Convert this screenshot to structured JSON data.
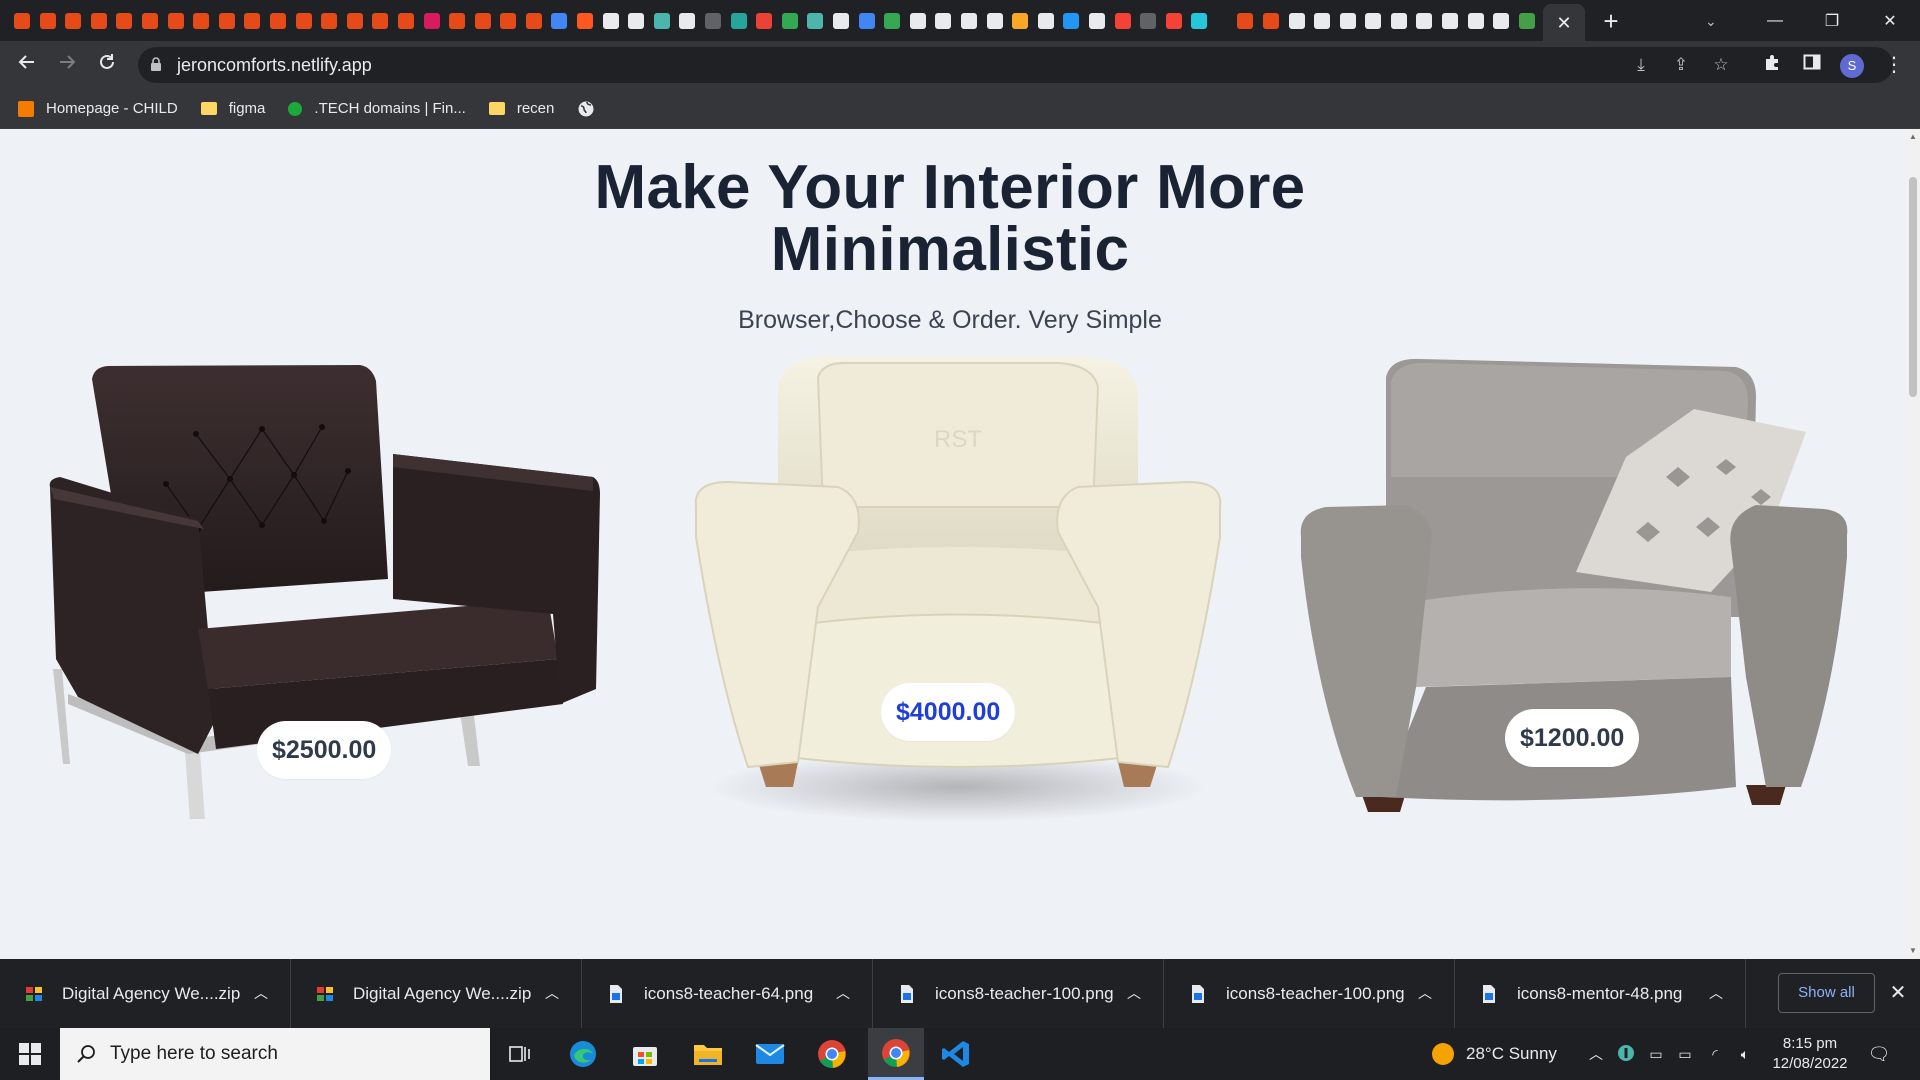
{
  "browser": {
    "favicon_colors": [
      "#e64a19",
      "#e64a19",
      "#e64a19",
      "#e64a19",
      "#e64a19",
      "#e64a19",
      "#e64a19",
      "#e64a19",
      "#e64a19",
      "#e64a19",
      "#e64a19",
      "#e64a19",
      "#e64a19",
      "#e64a19",
      "#e64a19",
      "#e64a19",
      "#d81b60",
      "#e64a19",
      "#e64a19",
      "#e64a19",
      "#e64a19",
      "#4285f4",
      "#ff5722",
      "#e8eaed",
      "#e8eaed",
      "#4db6ac",
      "#e8eaed",
      "#5f6368",
      "#26a69a",
      "#ea4335",
      "#34a853",
      "#4db6ac",
      "#e8eaed",
      "#4285f4",
      "#34a853",
      "#e8eaed",
      "#e8eaed",
      "#e8eaed",
      "#e8eaed",
      "#f9a825",
      "#e8eaed",
      "#2196f3",
      "#e8eaed",
      "#f44336",
      "#5f6368",
      "#f44336",
      "#26c6da",
      "#e64a19",
      "#e64a19",
      "#e8eaed",
      "#e8eaed",
      "#e8eaed",
      "#e8eaed",
      "#e8eaed",
      "#e8eaed",
      "#e8eaed",
      "#e8eaed",
      "#e8eaed",
      "#43a047",
      "#e8eaed"
    ],
    "active_tab_close": "✕",
    "new_tab": "+",
    "window_controls": {
      "search_tabs": "⌄",
      "minimize": "—",
      "restore": "❐",
      "close": "✕"
    },
    "url": "jeroncomforts.netlify.app",
    "toolbar_icons": [
      "install-icon",
      "share-icon",
      "star-icon",
      "extensions-icon",
      "sidepanel-icon"
    ],
    "profile_initial": "S"
  },
  "bookmarks": [
    {
      "label": "Homepage - CHILD",
      "icon": "child-site-icon",
      "color": "#f57c00"
    },
    {
      "label": "figma",
      "icon": "folder-icon",
      "color": "#fdd663"
    },
    {
      "label": ".TECH domains | Fin...",
      "icon": "green-dot-icon",
      "color": "#1fa83a"
    },
    {
      "label": "recen",
      "icon": "folder-icon",
      "color": "#fdd663"
    },
    {
      "label": "",
      "icon": "globe-icon",
      "color": "#e8eaed"
    }
  ],
  "page": {
    "title_line1": "Make Your Interior More",
    "title_line2": "Minimalistic",
    "subtitle": "Browser,Choose & Order. Very Simple",
    "products": [
      {
        "name": "black leather armchair",
        "price": "$2500.00",
        "highlight": false
      },
      {
        "name": "cream leather armchair",
        "price": "$4000.00",
        "highlight": true
      },
      {
        "name": "grey fabric armchair",
        "price": "$1200.00",
        "highlight": false
      }
    ]
  },
  "downloads": {
    "items": [
      {
        "name": "Digital Agency We....zip",
        "type": "zip"
      },
      {
        "name": "Digital Agency We....zip",
        "type": "zip"
      },
      {
        "name": "icons8-teacher-64.png",
        "type": "png"
      },
      {
        "name": "icons8-teacher-100.png",
        "type": "png"
      },
      {
        "name": "icons8-teacher-100.png",
        "type": "png"
      },
      {
        "name": "icons8-mentor-48.png",
        "type": "png"
      }
    ],
    "show_all": "Show all",
    "close": "✕"
  },
  "taskbar": {
    "search_placeholder": "Type here to search",
    "weather": "28°C  Sunny",
    "time": "8:15 pm",
    "date": "12/08/2022"
  }
}
